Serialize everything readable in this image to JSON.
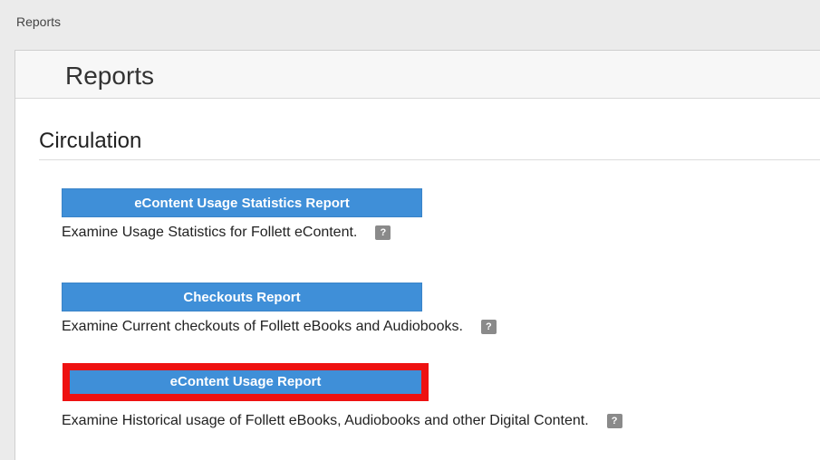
{
  "breadcrumb": "Reports",
  "panel": {
    "title": "Reports"
  },
  "section": {
    "title": "Circulation"
  },
  "reports": [
    {
      "button_label": "eContent Usage Statistics Report",
      "description": "Examine Usage Statistics for Follett eContent.",
      "help_label": "?"
    },
    {
      "button_label": "Checkouts Report",
      "description": "Examine Current checkouts of Follett eBooks and Audiobooks.",
      "help_label": "?"
    },
    {
      "button_label": "eContent Usage Report",
      "description": "Examine Historical usage of Follett eBooks, Audiobooks and other Digital Content.",
      "help_label": "?"
    }
  ],
  "colors": {
    "button": "#3f8fd8",
    "highlight": "#ee1111",
    "panel_bg": "#ffffff",
    "page_bg": "#ebebeb"
  }
}
